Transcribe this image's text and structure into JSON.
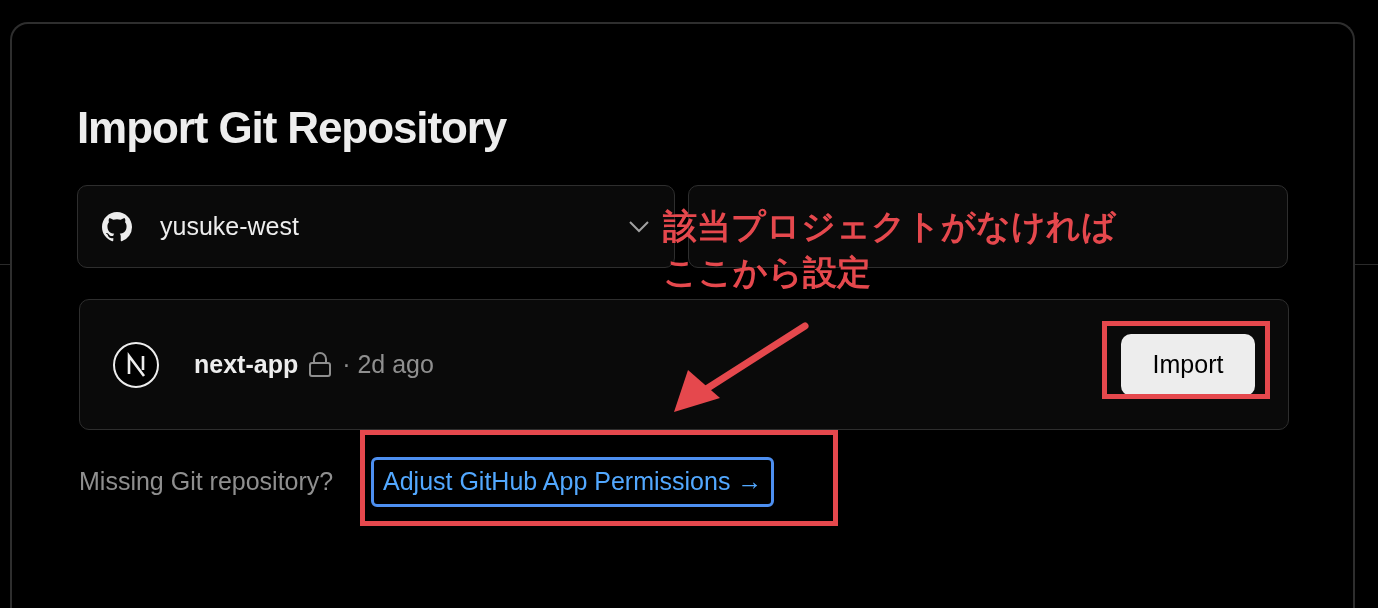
{
  "dialog": {
    "title": "Import Git Repository",
    "account_select": {
      "value": "yusuke-west"
    },
    "search": {
      "bordered": true
    },
    "repositories": [
      {
        "name": "next-app",
        "private": true,
        "updated": "· 2d ago",
        "action": "Import"
      }
    ],
    "footer": {
      "text": "Missing Git repository?",
      "link": "Adjust GitHub App Permissions →",
      "link_focused": true
    }
  },
  "annotations": [
    {
      "kind": "note",
      "lines": [
        "該当プロジェクトがなければ",
        "ここから設定"
      ]
    },
    {
      "kind": "arrow"
    },
    {
      "kind": "box"
    },
    {
      "kind": "box"
    }
  ]
}
